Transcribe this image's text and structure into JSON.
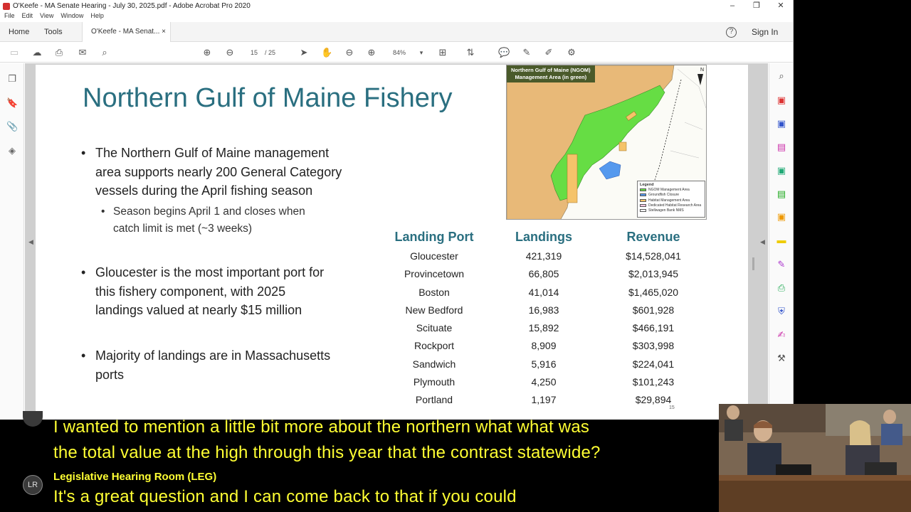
{
  "window": {
    "title": "O'Keefe - MA Senate Hearing - July 30, 2025.pdf - Adobe Acrobat Pro 2020",
    "controls": [
      "–",
      "❐",
      "✕"
    ]
  },
  "menu": [
    "File",
    "Edit",
    "View",
    "Window",
    "Help"
  ],
  "tabs": {
    "home": "Home",
    "tools": "Tools",
    "document": "O'Keefe - MA Senat...",
    "close": "×"
  },
  "header": {
    "help": "?",
    "sign_in": "Sign In"
  },
  "toolbar": {
    "current_page": "15",
    "total_pages": "/ 25",
    "zoom": "84%"
  },
  "slide": {
    "title": "Northern Gulf of Maine Fishery",
    "bullets": [
      {
        "lines": [
          "The Northern Gulf of Maine management",
          "area supports nearly 200 General Category",
          "vessels during the April fishing season"
        ]
      },
      {
        "lines": [
          "Gloucester is the most important port for",
          "this fishery component, with 2025",
          "landings valued at nearly $15 million"
        ]
      },
      {
        "lines": [
          "Majority of landings are in Massachusetts",
          "ports"
        ]
      }
    ],
    "subbullet": {
      "lines": [
        "Season begins April 1 and closes when",
        "catch limit is met (~3 weeks)"
      ]
    },
    "map": {
      "title_line1": "Northern Gulf of Maine (NGOM)",
      "title_line2": "Management Area (in green)",
      "legend_title": "Legend",
      "legend_items": [
        {
          "label": "NGOM Management Area",
          "color": "#66dd44"
        },
        {
          "label": "Groundfish Closure",
          "color": "#5599ee"
        },
        {
          "label": "Habitat Management Area",
          "color": "#f5c36a"
        },
        {
          "label": "Dedicated Habitat Research Area",
          "color": "#f7c6e0"
        },
        {
          "label": "Stellwagen Bank NMS",
          "color": "#ffffff"
        }
      ]
    },
    "table": {
      "headers": [
        "Landing Port",
        "Landings",
        "Revenue"
      ],
      "rows": [
        [
          "Gloucester",
          "421,319",
          "$14,528,041"
        ],
        [
          "Provincetown",
          "66,805",
          "$2,013,945"
        ],
        [
          "Boston",
          "41,014",
          "$1,465,020"
        ],
        [
          "New Bedford",
          "16,983",
          "$601,928"
        ],
        [
          "Scituate",
          "15,892",
          "$466,191"
        ],
        [
          "Rockport",
          "8,909",
          "$303,998"
        ],
        [
          "Sandwich",
          "5,916",
          "$224,041"
        ],
        [
          "Plymouth",
          "4,250",
          "$101,243"
        ],
        [
          "Portland",
          "1,197",
          "$29,894"
        ]
      ]
    },
    "page_number": "15"
  },
  "captions": {
    "line1": "I wanted to mention a little bit more about the northern what what was",
    "line2": "the total value at the high through this year that the contrast statewide?",
    "speaker_initials": "LR",
    "speaker_name": "Legislative Hearing Room (LEG)",
    "line3": "It's a great question and I can come back to that if you could"
  },
  "colors": {
    "title_teal": "#2a6f80",
    "caption_yellow": "#ffff33",
    "map_green": "#66dd44",
    "map_land": "#e8b978"
  }
}
